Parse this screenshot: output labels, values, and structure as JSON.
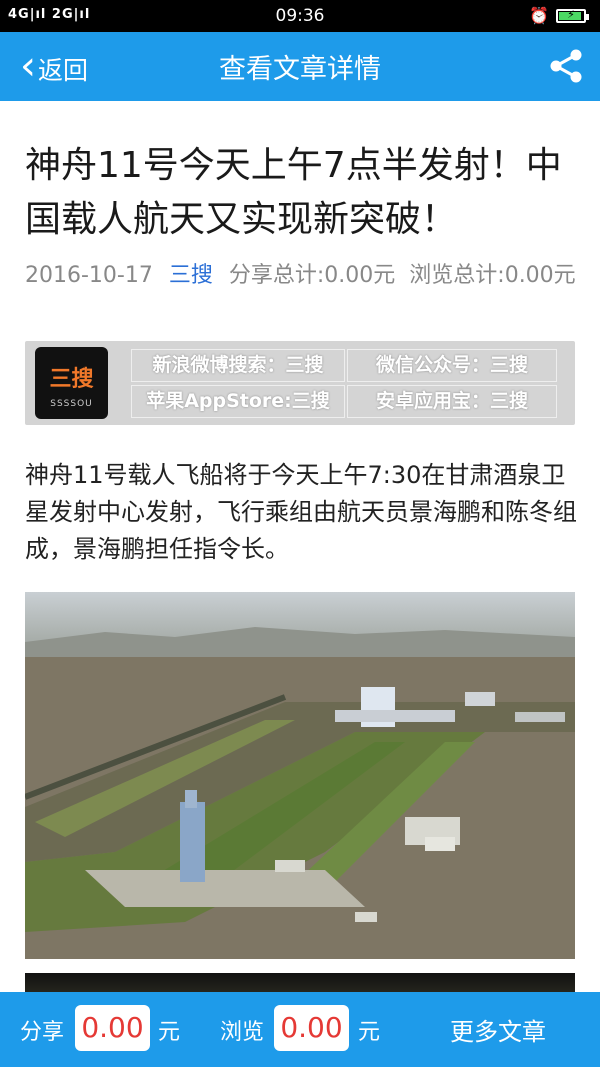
{
  "status_bar": {
    "signal": "4G|ıl 2G|ıl",
    "time": "09:36",
    "battery_level": 0.85
  },
  "nav": {
    "back_label": "返回",
    "title": "查看文章详情"
  },
  "article": {
    "title": "神舟11号今天上午7点半发射！中国载人航天又实现新突破！",
    "date": "2016-10-17",
    "source": "三搜",
    "share_total": "分享总计:0.00元",
    "view_total": "浏览总计:0.00元",
    "paragraph": "神舟11号载人飞船将于今天上午7:30在甘肃酒泉卫星发射中心发射，飞行乘组由航天员景海鹏和陈冬组成，景海鹏担任指令长。"
  },
  "banner": {
    "logo_text": "三搜",
    "logo_sub": "SSSSOU",
    "cells": [
      "新浪微博搜索：三搜",
      "微信公众号：三搜",
      "苹果AppStore:三搜",
      "安卓应用宝：三搜"
    ]
  },
  "bottom": {
    "share_label": "分享",
    "share_amount": "0.00",
    "view_label": "浏览",
    "view_amount": "0.00",
    "unit": "元",
    "more_label": "更多文章"
  },
  "colors": {
    "nav_bg": "#1e9bea",
    "source_link": "#2b6fd6",
    "amount": "#e53935"
  }
}
